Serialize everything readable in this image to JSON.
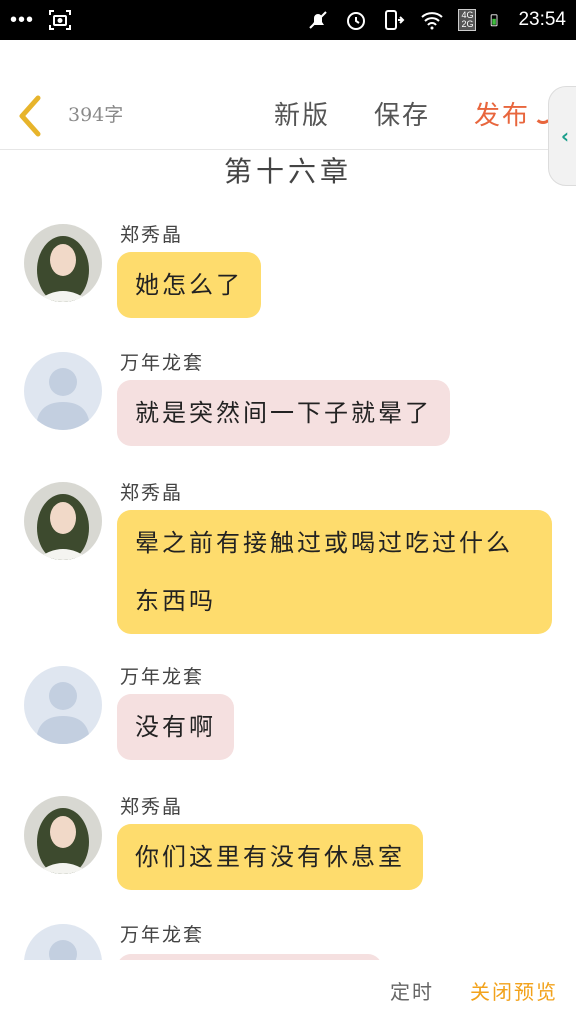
{
  "status_bar": {
    "dots": "•••",
    "network": [
      "4G",
      "2G"
    ],
    "time": "23:54"
  },
  "header": {
    "word_count": "394字",
    "new_version": "新版",
    "save": "保存",
    "publish": "发布",
    "side_tab_icon": "‹"
  },
  "chapter_title": "第十六章",
  "messages": [
    {
      "sender": "郑秀晶",
      "text": "她怎么了",
      "color": "#fedc6d"
    },
    {
      "sender": "万年龙套",
      "text": "就是突然间一下子就晕了",
      "color": "#f5e0e0"
    },
    {
      "sender": "郑秀晶",
      "text": "晕之前有接触过或喝过吃过什么东西吗",
      "color": "#fedc6d"
    },
    {
      "sender": "万年龙套",
      "text": "没有啊",
      "color": "#f5e0e0"
    },
    {
      "sender": "郑秀晶",
      "text": "你们这里有没有休息室",
      "color": "#fedc6d"
    },
    {
      "sender": "万年龙套",
      "text": "",
      "color": "#f5e0e0"
    }
  ],
  "bottom_bar": {
    "timer": "定时",
    "close_preview": "关闭预览"
  },
  "colors": {
    "publish": "#e8663d",
    "close_preview": "#f2a21b",
    "side_tab_arrow": "#1a9e8b"
  }
}
